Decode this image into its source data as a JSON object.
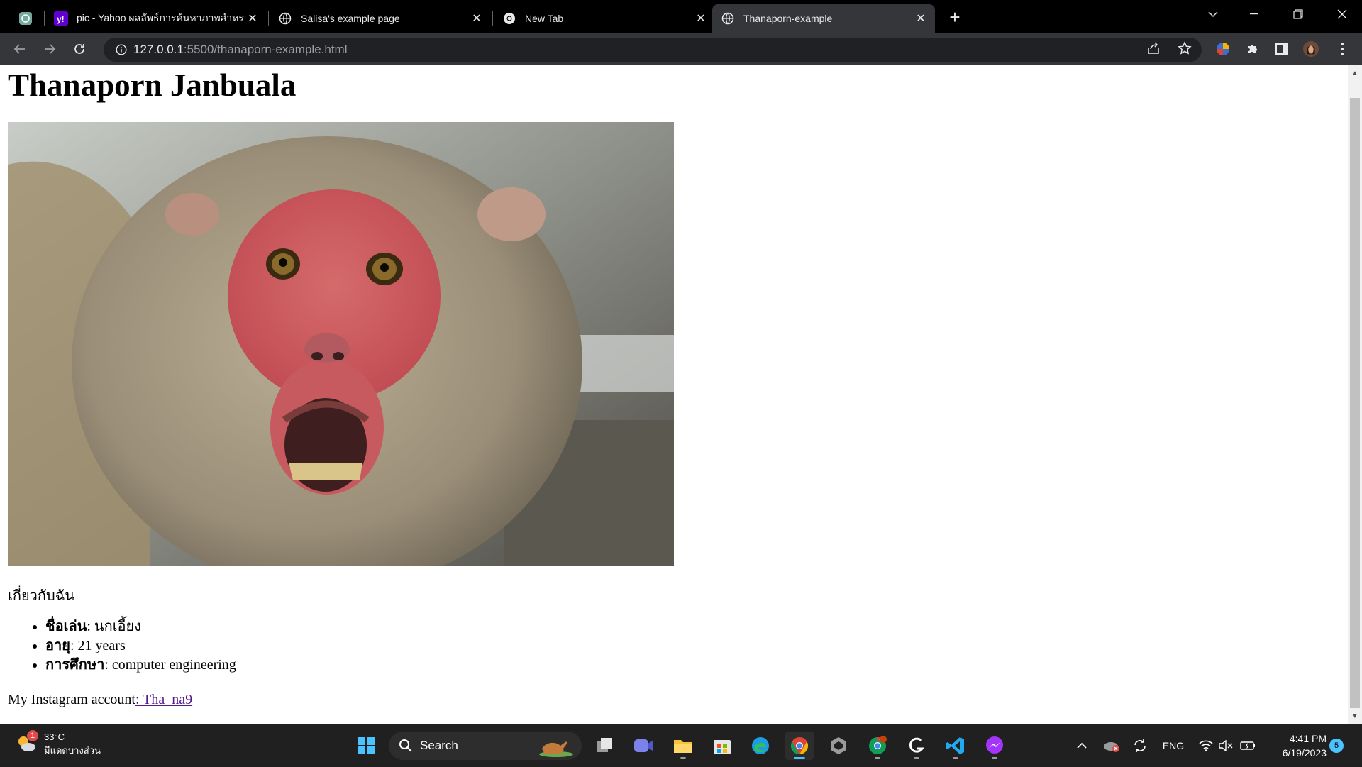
{
  "browser": {
    "tabs": [
      {
        "title": "",
        "favicon": "chatgpt-icon",
        "active": false
      },
      {
        "title": "pic - Yahoo ผลลัพธ์การค้นหาภาพสำหร",
        "favicon": "yahoo-icon",
        "active": false
      },
      {
        "title": "Salisa's example page",
        "favicon": "globe-icon",
        "active": false
      },
      {
        "title": "New Tab",
        "favicon": "chrome-icon",
        "active": false
      },
      {
        "title": "Thanaporn-example",
        "favicon": "globe-icon",
        "active": true
      }
    ],
    "url_host": "127.0.0.1",
    "url_rest": ":5500/thanaporn-example.html"
  },
  "page": {
    "title": "Thanaporn Janbuala",
    "image_alt": "Monkey",
    "about_heading": "เกี่ยวกับฉัน",
    "info": [
      {
        "label": "ชื่อเล่น",
        "value": ": นกเอี้ยง"
      },
      {
        "label": "อายุ",
        "value": ": 21 years"
      },
      {
        "label": "การศึกษา",
        "value": ": computer engineering"
      }
    ],
    "instagram_prefix": "My Instagram account",
    "instagram_link": ": Tha_na9"
  },
  "taskbar": {
    "weather_temp": "33°C",
    "weather_desc": "มีแดดบางส่วน",
    "weather_badge": "1",
    "search_label": "Search",
    "lang": "ENG",
    "time": "4:41 PM",
    "date": "6/19/2023",
    "notification_count": "5"
  },
  "colors": {
    "link": "#551a8b",
    "tabstrip": "#000000",
    "toolbar": "#35363a",
    "taskbar": "#202020",
    "accent": "#4cc2ff"
  }
}
